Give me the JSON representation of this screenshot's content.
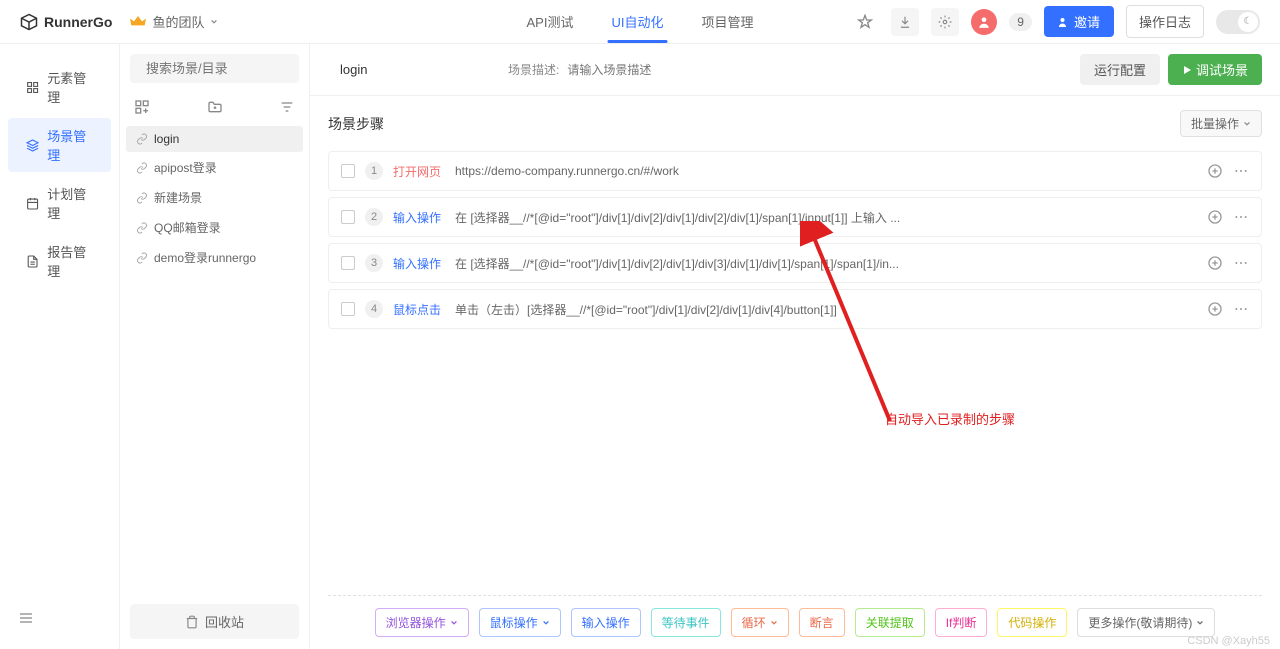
{
  "header": {
    "logo_text": "RunnerGo",
    "team_name": "鱼的团队",
    "nav": [
      {
        "label": "API测试",
        "active": false
      },
      {
        "label": "UI自动化",
        "active": true
      },
      {
        "label": "项目管理",
        "active": false
      }
    ],
    "count": "9",
    "invite_label": "邀请",
    "log_label": "操作日志"
  },
  "left_nav": [
    {
      "label": "元素管理",
      "icon": "grid",
      "active": false
    },
    {
      "label": "场景管理",
      "icon": "layers",
      "active": true
    },
    {
      "label": "计划管理",
      "icon": "calendar",
      "active": false
    },
    {
      "label": "报告管理",
      "icon": "report",
      "active": false
    }
  ],
  "scene_panel": {
    "search_placeholder": "搜索场景/目录",
    "items": [
      {
        "name": "login",
        "active": true
      },
      {
        "name": "apipost登录",
        "active": false
      },
      {
        "name": "新建场景",
        "active": false
      },
      {
        "name": "QQ邮箱登录",
        "active": false
      },
      {
        "name": "demo登录runnergo",
        "active": false
      }
    ],
    "recycle_label": "回收站"
  },
  "scene": {
    "name": "login",
    "desc_label": "场景描述:",
    "desc_placeholder": "请输入场景描述",
    "config_btn": "运行配置",
    "debug_btn": "调试场景",
    "steps_title": "场景步骤",
    "batch_label": "批量操作"
  },
  "steps": [
    {
      "num": "1",
      "type": "打开网页",
      "type_class": "open",
      "content": "https://demo-company.runnergo.cn/#/work"
    },
    {
      "num": "2",
      "type": "输入操作",
      "type_class": "input",
      "content": "在 [选择器__//*[@id=\"root\"]/div[1]/div[2]/div[1]/div[2]/div[1]/span[1]/input[1]] 上输入 ..."
    },
    {
      "num": "3",
      "type": "输入操作",
      "type_class": "input",
      "content": "在 [选择器__//*[@id=\"root\"]/div[1]/div[2]/div[1]/div[3]/div[1]/div[1]/span[1]/span[1]/in..."
    },
    {
      "num": "4",
      "type": "鼠标点击",
      "type_class": "click",
      "content": "单击（左击）[选择器__//*[@id=\"root\"]/div[1]/div[2]/div[1]/div[4]/button[1]]"
    }
  ],
  "annotation": "自动导入已录制的步骤",
  "actions": {
    "browser": "浏览器操作",
    "mouse": "鼠标操作",
    "input": "输入操作",
    "wait": "等待事件",
    "loop": "循环",
    "assert": "断言",
    "extract": "关联提取",
    "if": "If判断",
    "code": "代码操作",
    "more": "更多操作(敬请期待)"
  },
  "watermark": "CSDN @Xayh55"
}
